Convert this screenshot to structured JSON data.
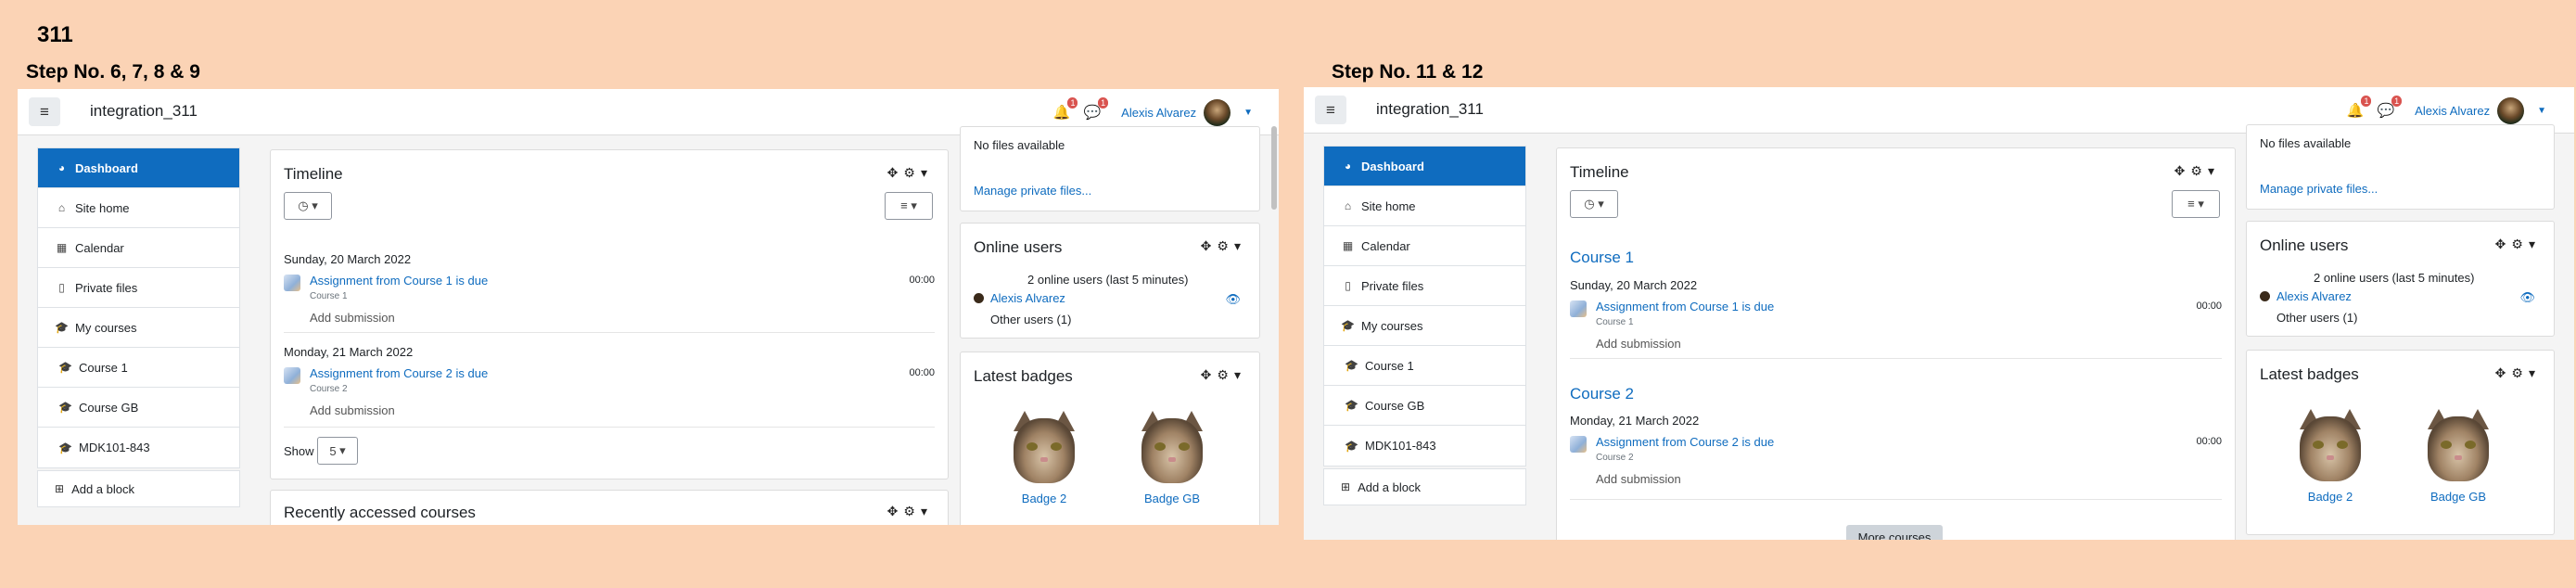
{
  "doc_title": "311",
  "left": {
    "step_label": "Step No. 6, 7, 8 & 9",
    "site_name": "integration_311",
    "user_name": "Alexis Alvarez",
    "notif_count": "1",
    "msg_count": "1",
    "nav": [
      {
        "label": "Dashboard",
        "icon": "dashboard-icon",
        "glyph": "◕",
        "active": true
      },
      {
        "label": "Site home",
        "icon": "home-icon",
        "glyph": "⌂"
      },
      {
        "label": "Calendar",
        "icon": "calendar-icon",
        "glyph": "▦"
      },
      {
        "label": "Private files",
        "icon": "file-icon",
        "glyph": "▯"
      },
      {
        "label": "My courses",
        "icon": "graduation-cap-icon",
        "glyph": "🎓"
      },
      {
        "label": "Course 1",
        "icon": "graduation-cap-icon",
        "glyph": "🎓"
      },
      {
        "label": "Course GB",
        "icon": "graduation-cap-icon",
        "glyph": "🎓"
      },
      {
        "label": "MDK101-843",
        "icon": "graduation-cap-icon",
        "glyph": "🎓"
      }
    ],
    "add_block": "Add a block",
    "timeline": {
      "title": "Timeline",
      "events": [
        {
          "date": "Sunday, 20 March 2022",
          "name": "Assignment from Course 1 is due",
          "course": "Course 1",
          "time": "00:00",
          "action": "Add submission"
        },
        {
          "date": "Monday, 21 March 2022",
          "name": "Assignment from Course 2 is due",
          "course": "Course 2",
          "time": "00:00",
          "action": "Add submission"
        }
      ],
      "show_label": "Show",
      "show_value": "5"
    },
    "recent_title": "Recently accessed courses",
    "files": {
      "empty": "No files available",
      "manage": "Manage private files..."
    },
    "online": {
      "title": "Online users",
      "summary": "2 online users (last 5 minutes)",
      "user": "Alexis Alvarez",
      "other": "Other users (1)"
    },
    "badges": {
      "title": "Latest badges",
      "items": [
        "Badge 2",
        "Badge GB"
      ]
    }
  },
  "right": {
    "step_label": "Step No. 11 & 12",
    "site_name": "integration_311",
    "user_name": "Alexis Alvarez",
    "notif_count": "1",
    "msg_count": "1",
    "nav": [
      {
        "label": "Dashboard",
        "icon": "dashboard-icon",
        "glyph": "◕",
        "active": true
      },
      {
        "label": "Site home",
        "icon": "home-icon",
        "glyph": "⌂"
      },
      {
        "label": "Calendar",
        "icon": "calendar-icon",
        "glyph": "▦"
      },
      {
        "label": "Private files",
        "icon": "file-icon",
        "glyph": "▯"
      },
      {
        "label": "My courses",
        "icon": "graduation-cap-icon",
        "glyph": "🎓"
      },
      {
        "label": "Course 1",
        "icon": "graduation-cap-icon",
        "glyph": "🎓"
      },
      {
        "label": "Course GB",
        "icon": "graduation-cap-icon",
        "glyph": "🎓"
      },
      {
        "label": "MDK101-843",
        "icon": "graduation-cap-icon",
        "glyph": "🎓"
      }
    ],
    "add_block": "Add a block",
    "timeline": {
      "title": "Timeline",
      "groups": [
        {
          "course": "Course 1",
          "date": "Sunday, 20 March 2022",
          "name": "Assignment from Course 1 is due",
          "course_small": "Course 1",
          "time": "00:00",
          "action": "Add submission"
        },
        {
          "course": "Course 2",
          "date": "Monday, 21 March 2022",
          "name": "Assignment from Course 2 is due",
          "course_small": "Course 2",
          "time": "00:00",
          "action": "Add submission"
        }
      ],
      "more": "More courses"
    },
    "files": {
      "empty": "No files available",
      "manage": "Manage private files..."
    },
    "online": {
      "title": "Online users",
      "summary": "2 online users (last 5 minutes)",
      "user": "Alexis Alvarez",
      "other": "Other users (1)"
    },
    "badges": {
      "title": "Latest badges",
      "items": [
        "Badge 2",
        "Badge GB"
      ]
    }
  }
}
